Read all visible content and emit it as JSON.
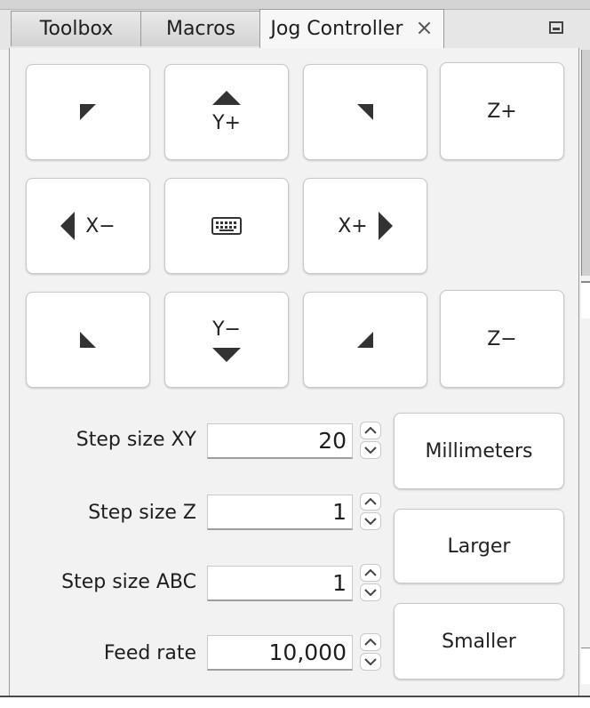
{
  "tabs": [
    {
      "label": "Toolbox",
      "active": false
    },
    {
      "label": "Macros",
      "active": false
    },
    {
      "label": "Jog Controller",
      "active": true
    }
  ],
  "tab_close_glyph": "×",
  "jog": {
    "y_plus": "Y+",
    "y_minus": "Y−",
    "x_minus": "X−",
    "x_plus": "X+",
    "z_plus": "Z+",
    "z_minus": "Z−",
    "keyboard_icon": "keyboard-icon"
  },
  "settings": {
    "step_xy_label": "Step size XY",
    "step_xy_value": "20",
    "step_z_label": "Step size Z",
    "step_z_value": "1",
    "step_abc_label": "Step size ABC",
    "step_abc_value": "1",
    "feed_label": "Feed rate",
    "feed_value": "10,000"
  },
  "buttons": {
    "units": "Millimeters",
    "larger": "Larger",
    "smaller": "Smaller"
  },
  "colors": {
    "button_bg": "#ffffff",
    "panel_bg": "#f2f2f2",
    "glyph": "#333333"
  }
}
